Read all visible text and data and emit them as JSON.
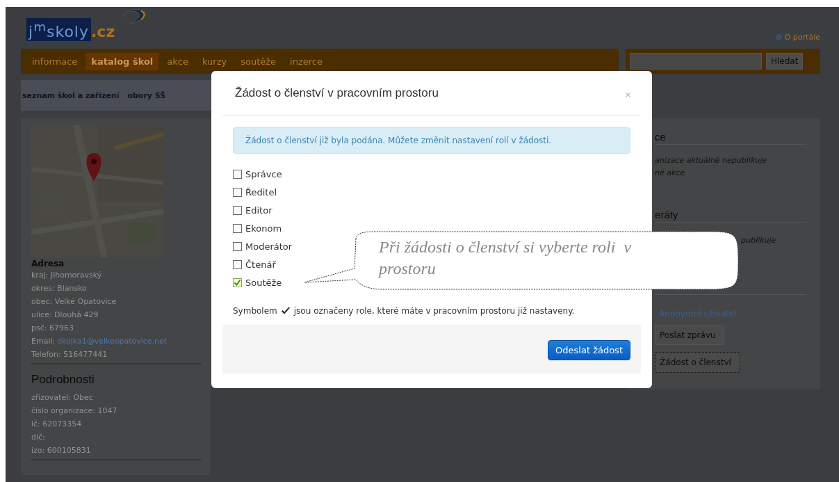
{
  "header": {
    "logo": {
      "main": "j$^{m}$skoly",
      "suffix": ".cz"
    },
    "about_link": "O portále",
    "search": {
      "button": "Hledat"
    }
  },
  "nav": [
    {
      "label": "informace",
      "selected": false
    },
    {
      "label": "katalog škol",
      "selected": true
    },
    {
      "label": "akce",
      "selected": false
    },
    {
      "label": "kurzy",
      "selected": false
    },
    {
      "label": "soutěže",
      "selected": false
    },
    {
      "label": "inzerce",
      "selected": false
    }
  ],
  "subnav": [
    "seznam škol a zařízení",
    "obory SŠ"
  ],
  "sidebar": {
    "address": {
      "heading": "Adresa",
      "lines": [
        "kraj: Jihomoravský",
        "okres: Blansko",
        "obec: Velké Opatovice",
        "ulice: Dlouhá 429",
        "psč: 67963"
      ],
      "email": {
        "label": "Email:",
        "address": "skolka1@velkeopatovice.net"
      },
      "phone": "Telefon: 516477441"
    },
    "details": {
      "heading": "Podrobnosti",
      "lines": [
        "zřizovatel: Obec",
        "číslo organizace: 1047",
        "ič: 62073354",
        "dič:",
        "izo: 600105831"
      ]
    }
  },
  "right_column": {
    "events_heading": "ce",
    "events_text": [
      "anizace aktuálně nepublikuje",
      "né akce"
    ],
    "referrals_heading": "eráty",
    "referrals_text": "publikuje",
    "user_link": "Anonymní uživatel",
    "buttons": [
      "Poslat zprávu",
      "Žádost o členství"
    ]
  },
  "modal": {
    "title": "Žádost o členství v pracovním prostoru",
    "close": "×",
    "alert": "Žádost o členství již byla podána. Můžete změnit nastavení rolí v žádosti.",
    "roles": [
      {
        "label": "Správce",
        "checked": false
      },
      {
        "label": "Ředitel",
        "checked": false
      },
      {
        "label": "Editor",
        "checked": false
      },
      {
        "label": "Ekonom",
        "checked": false
      },
      {
        "label": "Moderátor",
        "checked": false
      },
      {
        "label": "Čtenář",
        "checked": false
      },
      {
        "label": "Soutěže",
        "checked": true
      }
    ],
    "note": {
      "before": "Symbolem",
      "after": "jsou označeny role, které máte v pracovním prostoru již nastaveny."
    },
    "submit": "Odeslat žádost"
  },
  "callout": {
    "text": "Při žádosti o členství si vyberte roli  v prostoru"
  }
}
